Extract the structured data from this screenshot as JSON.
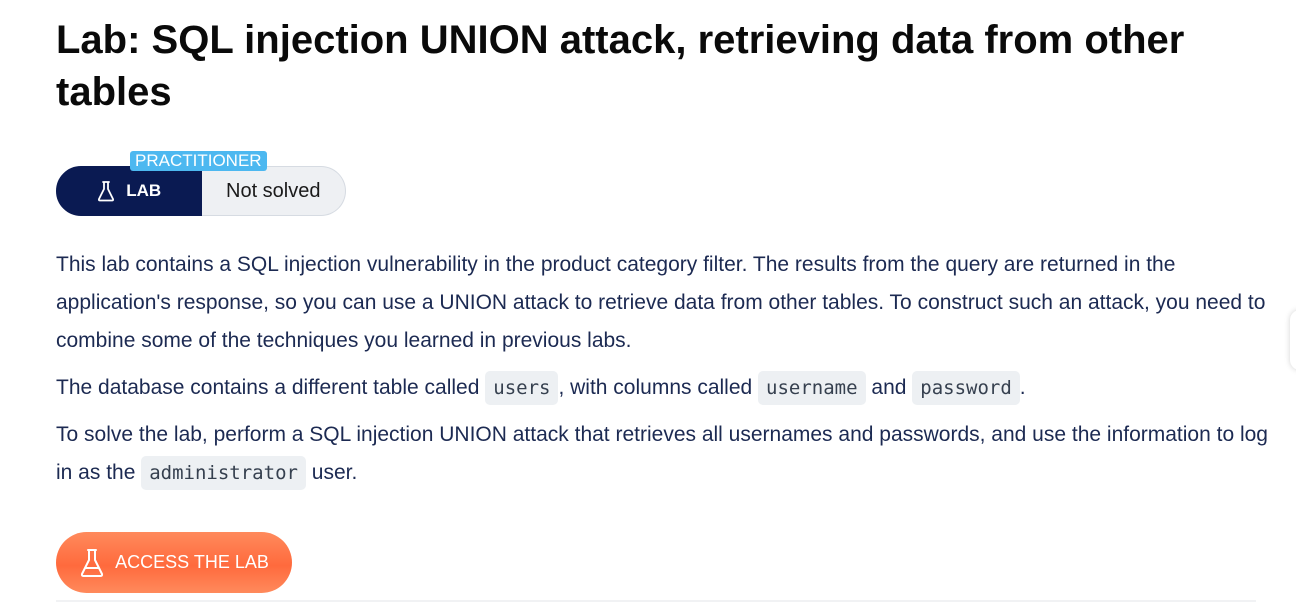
{
  "page": {
    "title": "Lab: SQL injection UNION attack, retrieving data from other tables"
  },
  "status_widget": {
    "level_badge": "PRACTITIONER",
    "lab_label": "LAB",
    "status": "Not solved"
  },
  "description": {
    "p1": "This lab contains a SQL injection vulnerability in the product category filter. The results from the query are returned in the application's response, so you can use a UNION attack to retrieve data from other tables. To construct such an attack, you need to combine some of the techniques you learned in previous labs.",
    "p2_text1": "The database contains a different table called ",
    "p2_code1": "users",
    "p2_text2": ", with columns called ",
    "p2_code2": "username",
    "p2_text3": " and ",
    "p2_code3": "password",
    "p2_text4": ".",
    "p3_text1": "To solve the lab, perform a SQL injection UNION attack that retrieves all usernames and passwords, and use the information to log in as the ",
    "p3_code1": "administrator",
    "p3_text2": " user."
  },
  "access_button": {
    "label": "ACCESS THE LAB"
  },
  "icons": {
    "lab_flask": "flask-icon",
    "access_flask": "flask-icon"
  },
  "colors": {
    "navy": "#0a1a52",
    "badge_blue": "#4db8f0",
    "accent_orange": "#ff6a3d",
    "code_bg": "#edf0f3"
  }
}
